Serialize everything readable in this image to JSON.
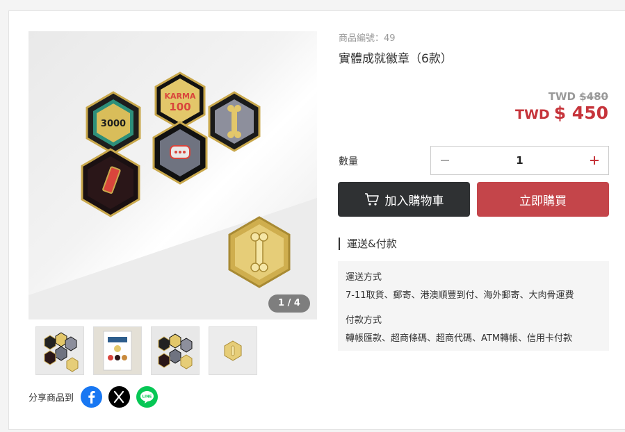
{
  "gallery": {
    "counter": "1 / 4",
    "thumbnails": [
      "thumbnail-1",
      "thumbnail-2",
      "thumbnail-3",
      "thumbnail-4"
    ]
  },
  "product": {
    "sku": "商品編號：49",
    "title": "實體成就徽章（6款）",
    "original_price_currency": "TWD",
    "original_price": "$480",
    "price_currency": "TWD",
    "price": "$ 450"
  },
  "quantity": {
    "label": "數量",
    "value": "1"
  },
  "actions": {
    "add_to_cart": "加入購物車",
    "buy_now": "立即購買"
  },
  "shipping": {
    "section_title": "運送&付款",
    "ship_heading": "運送方式",
    "ship_methods": "7-11取貨、郵寄、港澳順豐到付、海外郵寄、大肉骨運費",
    "pay_heading": "付款方式",
    "pay_methods": "轉帳匯款、超商條碼、超商代碼、ATM轉帳、信用卡付款"
  },
  "share": {
    "label": "分享商品到",
    "buttons": [
      "facebook-icon",
      "x-icon",
      "line-icon"
    ]
  },
  "colors": {
    "accent_red": "#c6343b",
    "buy_button": "#c4454a",
    "cart_button": "#2f3133",
    "facebook": "#1877f2",
    "line": "#06c755"
  }
}
